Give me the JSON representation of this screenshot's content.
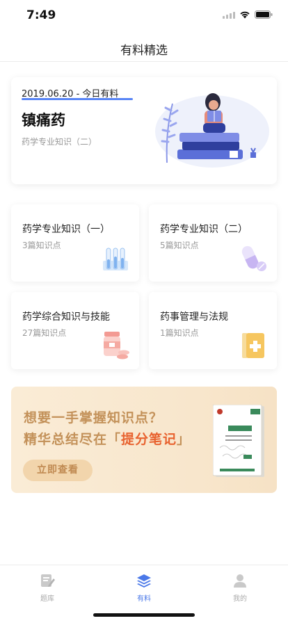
{
  "status_bar": {
    "time": "7:49"
  },
  "nav": {
    "title": "有料精选"
  },
  "featured": {
    "date": "2019.06.20 - 今日有料",
    "title": "镇痛药",
    "subtitle": "药学专业知识（二）",
    "illustration": "reading-girl-books-illustration"
  },
  "categories": [
    {
      "title": "药学专业知识（一）",
      "count": "3篇知识点",
      "icon": "test-tubes-icon"
    },
    {
      "title": "药学专业知识（二）",
      "count": "5篇知识点",
      "icon": "capsule-pills-icon"
    },
    {
      "title": "药学综合知识与技能",
      "count": "27篇知识点",
      "icon": "medicine-bottle-icon"
    },
    {
      "title": "药事管理与法规",
      "count": "1篇知识点",
      "icon": "medical-book-icon"
    }
  ],
  "promo": {
    "line1": "想要一手掌握知识点？",
    "line2_prefix": "精华总结尽在「",
    "line2_highlight": "提分笔记",
    "line2_suffix": "」",
    "button_label": "立即查看"
  },
  "tab_bar": {
    "items": [
      {
        "label": "题库",
        "icon": "question-bank-icon",
        "active": false
      },
      {
        "label": "有料",
        "icon": "layers-icon",
        "active": true
      },
      {
        "label": "我的",
        "icon": "person-icon",
        "active": false
      }
    ]
  },
  "colors": {
    "accent": "#4a78e8",
    "promo_text": "#c39159",
    "promo_highlight": "#e8622f",
    "underline": "#3b6ef5"
  }
}
